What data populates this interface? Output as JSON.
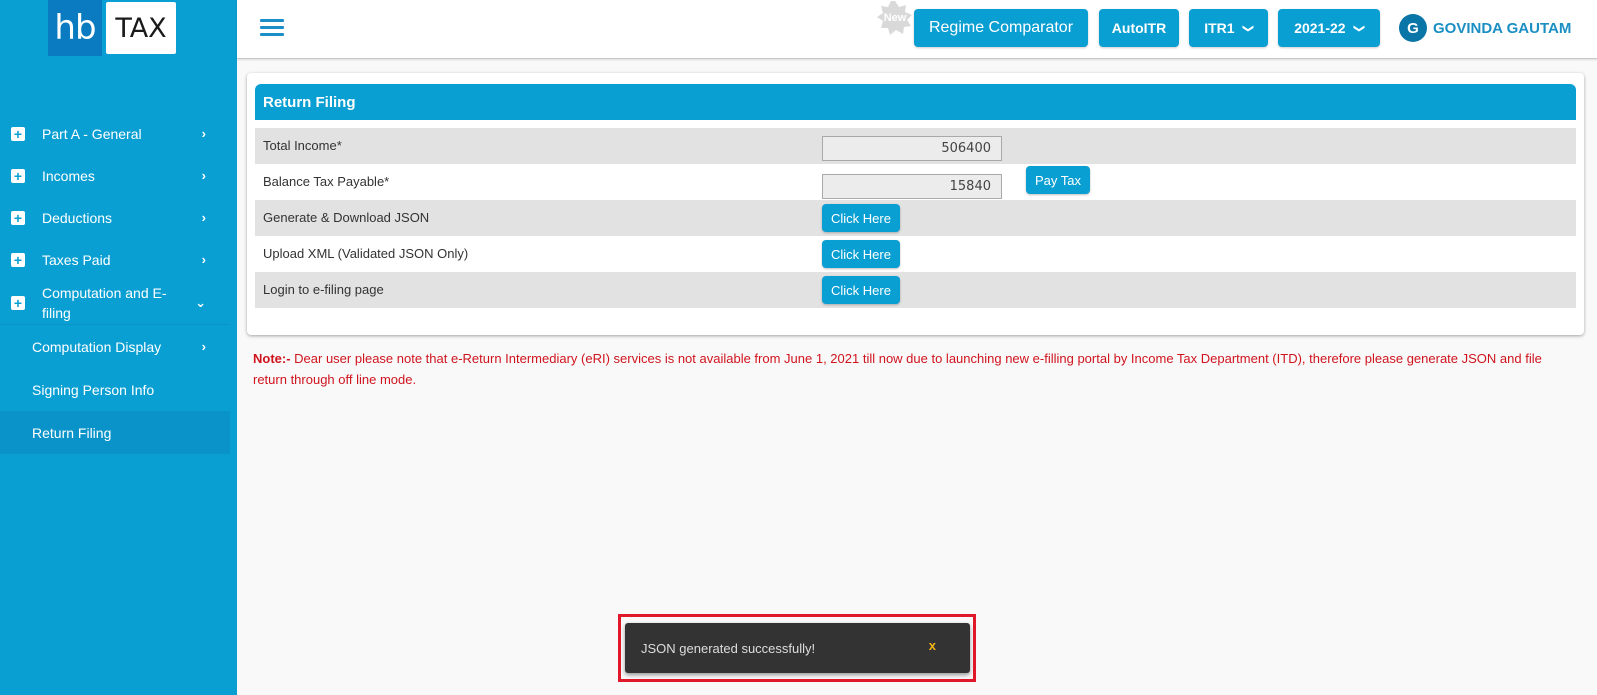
{
  "logo": {
    "left": "hb",
    "right": "TAX"
  },
  "sidebar": {
    "items": [
      {
        "label": "Part A - General",
        "icon": "plus-box-icon",
        "chevron": "›"
      },
      {
        "label": "Incomes",
        "icon": "plus-box-icon",
        "chevron": "›"
      },
      {
        "label": "Deductions",
        "icon": "plus-box-icon",
        "chevron": "›"
      },
      {
        "label": "Taxes Paid",
        "icon": "plus-box-icon",
        "chevron": "›"
      },
      {
        "label": "Computation and E-filing",
        "icon": "plus-box-icon",
        "chevron": "⌄",
        "expanded": true
      }
    ],
    "sub_items": [
      {
        "label": "Computation Display",
        "chevron": "›"
      },
      {
        "label": "Signing Person Info"
      },
      {
        "label": "Return Filing",
        "active": true
      }
    ]
  },
  "header": {
    "new_badge": "New",
    "regime_button": "Regime Comparator",
    "autoitr_button": "AutoITR",
    "itr_select": "ITR1",
    "year_select": "2021-22",
    "dropdown_glyph": "❯",
    "user_initial": "G",
    "user_name": "GOVINDA GAUTAM"
  },
  "card": {
    "title": "Return Filing",
    "rows": [
      {
        "label": "Total Income*",
        "value": "506400"
      },
      {
        "label": "Balance Tax Payable*",
        "value": "15840",
        "button": "Pay Tax"
      },
      {
        "label": "Generate & Download JSON",
        "button": "Click Here"
      },
      {
        "label": "Upload XML (Validated JSON Only)",
        "button": "Click Here"
      },
      {
        "label": "Login to e-filing page",
        "button": "Click Here"
      }
    ]
  },
  "note": {
    "prefix": "Note:-",
    "text": " Dear user please note that e-Return Intermediary (eRI) services is not available from June 1, 2021 till now due to launching new e-filling portal by Income Tax Department (ITD), therefore please generate JSON and file return through off line mode."
  },
  "toast": {
    "message": "JSON generated successfully!",
    "close": "x"
  },
  "colors": {
    "primary": "#0a9fd2",
    "logo_dark": "#0a7bc0",
    "note_red": "#d0141e",
    "toast_bg": "#333333",
    "toast_close": "#f2b21a",
    "highlight_frame": "#e0182a"
  }
}
